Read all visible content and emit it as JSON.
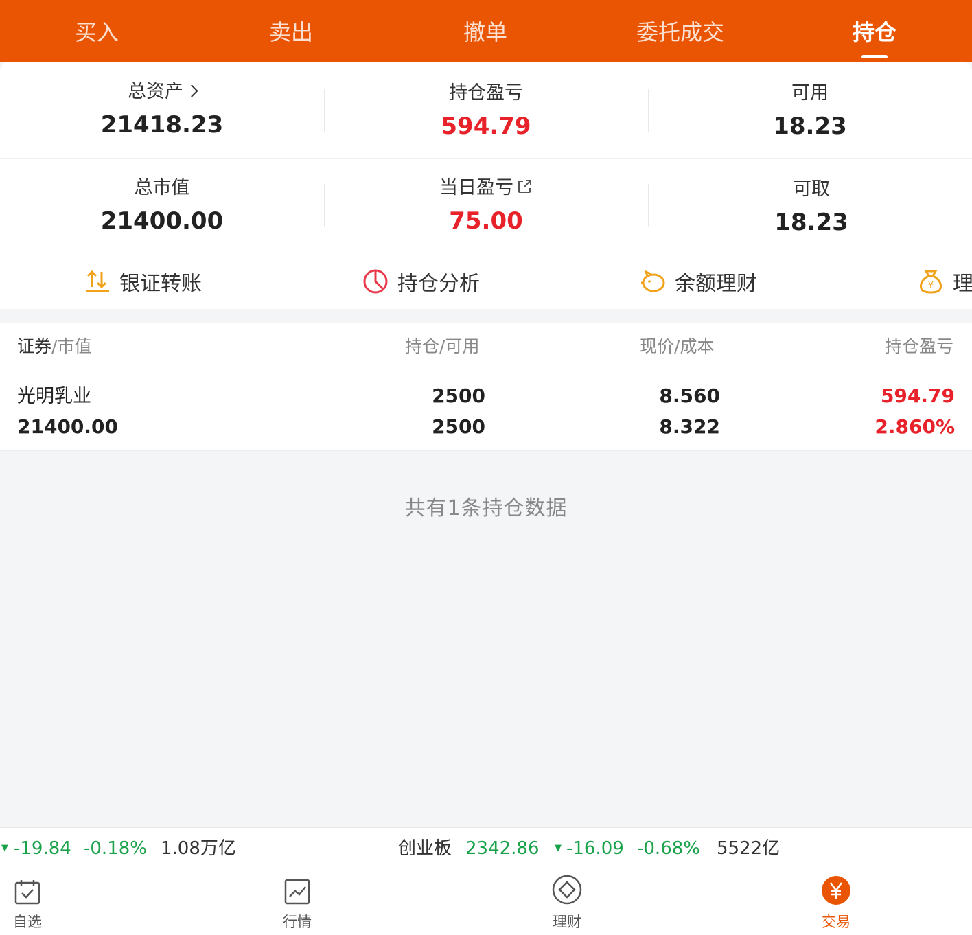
{
  "tabs": [
    "买入",
    "卖出",
    "撤单",
    "委托成交",
    "持仓"
  ],
  "active_tab": "持仓",
  "summary": {
    "total_assets_label": "总资产",
    "total_assets": "21418.23",
    "position_pnl_label": "持仓盈亏",
    "position_pnl": "594.79",
    "available_label": "可用",
    "available": "18.23",
    "market_value_label": "总市值",
    "market_value": "21400.00",
    "daily_pnl_label": "当日盈亏",
    "daily_pnl": "75.00",
    "withdrawable_label": "可取",
    "withdrawable": "18.23"
  },
  "actions": [
    "银证转账",
    "持仓分析",
    "余额理财",
    "理"
  ],
  "table": {
    "col1_main": "证券",
    "col1_sub": "市值",
    "col2_main": "持仓",
    "col2_sub": "可用",
    "col3_main": "现价",
    "col3_sub": "成本",
    "col4_main": "持仓盈亏",
    "sep": "/",
    "rows": [
      {
        "name": "光明乳业",
        "market_value": "21400.00",
        "position": "2500",
        "available": "2500",
        "price": "8.560",
        "cost": "8.322",
        "pnl": "594.79",
        "pnl_pct": "2.860%"
      }
    ]
  },
  "note": "共有1条持仓数据",
  "ticker": {
    "left": {
      "change": "-19.84",
      "pct": "-0.18%",
      "volume": "1.08万亿"
    },
    "right": {
      "name": "创业板",
      "index": "2342.86",
      "change": "-16.09",
      "pct": "-0.68%",
      "volume": "5522亿"
    },
    "down_arrow": "▼"
  },
  "nav": [
    "自选",
    "行情",
    "理财",
    "交易"
  ],
  "nav_active": "交易",
  "colors": {
    "brand": "#ea5504",
    "up": "#e8222a",
    "down": "#1aa24a"
  }
}
